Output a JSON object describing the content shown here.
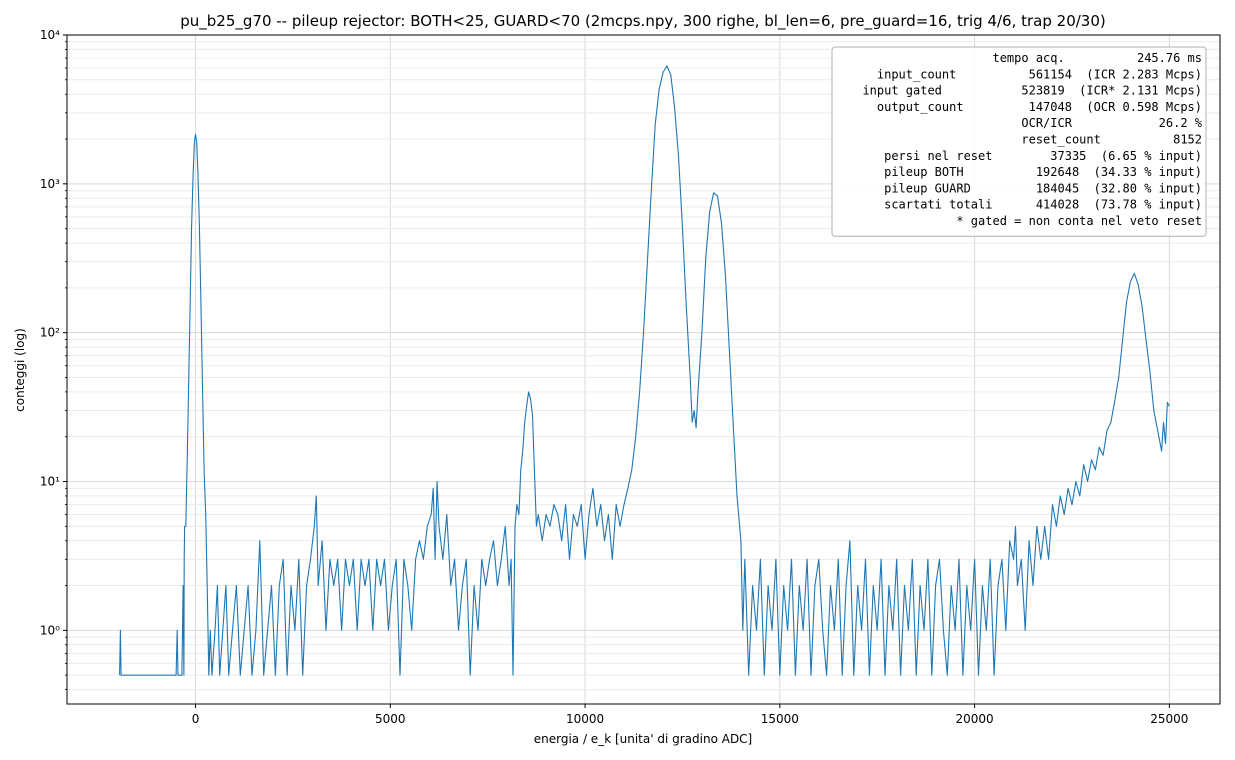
{
  "chart_data": {
    "type": "line",
    "title": "pu_b25_g70  --  pileup rejector: BOTH<25, GUARD<70   (2mcps.npy, 300 righe, bl_len=6, pre_guard=16, trig 4/6, trap 20/30)",
    "xlabel": "energia / e_k  [unita' di gradino ADC]",
    "ylabel": "conteggi (log)",
    "xlim": [
      -3300,
      26300
    ],
    "ylim": [
      0.32,
      10000
    ],
    "yscale": "log",
    "grid": true,
    "x_ticks": [
      0,
      5000,
      10000,
      15000,
      20000,
      25000
    ],
    "x_tick_labels": [
      "0",
      "5000",
      "10000",
      "15000",
      "20000",
      "25000"
    ],
    "y_ticks": [
      1,
      10,
      100,
      1000,
      10000
    ],
    "y_tick_labels": [
      "10⁰",
      "10¹",
      "10²",
      "10³",
      "10⁴"
    ],
    "line_color": "#1f77b4",
    "series": [
      {
        "name": "",
        "points": [
          [
            -1950,
            0.5
          ],
          [
            -1930,
            1.0
          ],
          [
            -1910,
            0.5
          ],
          [
            -500,
            0.5
          ],
          [
            -470,
            1.0
          ],
          [
            -450,
            0.5
          ],
          [
            -350,
            0.5
          ],
          [
            -320,
            2.0
          ],
          [
            -300,
            0.5
          ],
          [
            -290,
            3.0
          ],
          [
            -280,
            5.0
          ],
          [
            -250,
            5.0
          ],
          [
            -220,
            12
          ],
          [
            -180,
            40
          ],
          [
            -140,
            150
          ],
          [
            -100,
            520
          ],
          [
            -60,
            1200
          ],
          [
            -30,
            1900
          ],
          [
            0,
            2150
          ],
          [
            30,
            1900
          ],
          [
            60,
            1200
          ],
          [
            100,
            520
          ],
          [
            140,
            150
          ],
          [
            180,
            40
          ],
          [
            220,
            12
          ],
          [
            260,
            6
          ],
          [
            300,
            2.0
          ],
          [
            340,
            0.5
          ],
          [
            380,
            1.0
          ],
          [
            420,
            0.5
          ],
          [
            500,
            1.0
          ],
          [
            560,
            2.0
          ],
          [
            620,
            0.5
          ],
          [
            700,
            1.0
          ],
          [
            780,
            2.0
          ],
          [
            850,
            0.5
          ],
          [
            950,
            1.0
          ],
          [
            1050,
            2.0
          ],
          [
            1150,
            0.5
          ],
          [
            1250,
            1.0
          ],
          [
            1350,
            2.0
          ],
          [
            1450,
            0.5
          ],
          [
            1550,
            1.0
          ],
          [
            1650,
            4.0
          ],
          [
            1750,
            0.5
          ],
          [
            1850,
            1.0
          ],
          [
            1950,
            2.0
          ],
          [
            2050,
            0.5
          ],
          [
            2150,
            2.0
          ],
          [
            2250,
            3.0
          ],
          [
            2350,
            0.5
          ],
          [
            2450,
            2.0
          ],
          [
            2550,
            1.0
          ],
          [
            2650,
            3.0
          ],
          [
            2750,
            0.5
          ],
          [
            2850,
            2.0
          ],
          [
            2950,
            3.0
          ],
          [
            3050,
            5.0
          ],
          [
            3100,
            8.0
          ],
          [
            3150,
            2.0
          ],
          [
            3250,
            4.0
          ],
          [
            3350,
            1.0
          ],
          [
            3450,
            3.0
          ],
          [
            3550,
            2.0
          ],
          [
            3650,
            3.0
          ],
          [
            3750,
            1.0
          ],
          [
            3850,
            3.0
          ],
          [
            3950,
            2.0
          ],
          [
            4050,
            3.0
          ],
          [
            4150,
            1.0
          ],
          [
            4250,
            3.0
          ],
          [
            4350,
            2.0
          ],
          [
            4450,
            3.0
          ],
          [
            4550,
            1.0
          ],
          [
            4650,
            3.0
          ],
          [
            4750,
            2.0
          ],
          [
            4850,
            3.0
          ],
          [
            4950,
            1.0
          ],
          [
            5050,
            2.0
          ],
          [
            5150,
            3.0
          ],
          [
            5250,
            0.5
          ],
          [
            5350,
            3.0
          ],
          [
            5450,
            2.0
          ],
          [
            5550,
            1.0
          ],
          [
            5650,
            3.0
          ],
          [
            5750,
            4.0
          ],
          [
            5850,
            3.0
          ],
          [
            5950,
            5.0
          ],
          [
            6050,
            6.0
          ],
          [
            6100,
            9.0
          ],
          [
            6150,
            3.0
          ],
          [
            6200,
            10.0
          ],
          [
            6250,
            5.0
          ],
          [
            6350,
            3.0
          ],
          [
            6450,
            6.0
          ],
          [
            6550,
            2.0
          ],
          [
            6650,
            3.0
          ],
          [
            6750,
            1.0
          ],
          [
            6850,
            2.0
          ],
          [
            6950,
            3.0
          ],
          [
            7050,
            0.5
          ],
          [
            7150,
            2.0
          ],
          [
            7250,
            1.0
          ],
          [
            7350,
            3.0
          ],
          [
            7450,
            2.0
          ],
          [
            7550,
            3.0
          ],
          [
            7650,
            4.0
          ],
          [
            7750,
            2.0
          ],
          [
            7850,
            3.0
          ],
          [
            7950,
            5.0
          ],
          [
            8050,
            2.0
          ],
          [
            8100,
            3.0
          ],
          [
            8150,
            0.5
          ],
          [
            8200,
            5.0
          ],
          [
            8250,
            7.0
          ],
          [
            8300,
            6.0
          ],
          [
            8350,
            12
          ],
          [
            8400,
            16
          ],
          [
            8450,
            25
          ],
          [
            8500,
            32
          ],
          [
            8550,
            40
          ],
          [
            8600,
            36
          ],
          [
            8650,
            28
          ],
          [
            8700,
            12
          ],
          [
            8750,
            5.0
          ],
          [
            8800,
            6.0
          ],
          [
            8900,
            4.0
          ],
          [
            9000,
            6.0
          ],
          [
            9100,
            5.0
          ],
          [
            9200,
            7.0
          ],
          [
            9300,
            6.0
          ],
          [
            9400,
            4.0
          ],
          [
            9500,
            7.0
          ],
          [
            9600,
            3.0
          ],
          [
            9700,
            6.0
          ],
          [
            9800,
            5.0
          ],
          [
            9900,
            7.0
          ],
          [
            10000,
            3.0
          ],
          [
            10100,
            6.0
          ],
          [
            10200,
            9.0
          ],
          [
            10300,
            5.0
          ],
          [
            10400,
            7.0
          ],
          [
            10500,
            4.0
          ],
          [
            10600,
            6.0
          ],
          [
            10700,
            3.0
          ],
          [
            10800,
            7.0
          ],
          [
            10900,
            5.0
          ],
          [
            11000,
            7.0
          ],
          [
            11100,
            9.0
          ],
          [
            11200,
            12
          ],
          [
            11300,
            20
          ],
          [
            11400,
            40
          ],
          [
            11500,
            100
          ],
          [
            11600,
            300
          ],
          [
            11700,
            900
          ],
          [
            11800,
            2500
          ],
          [
            11900,
            4300
          ],
          [
            12000,
            5600
          ],
          [
            12100,
            6200
          ],
          [
            12200,
            5400
          ],
          [
            12300,
            3200
          ],
          [
            12400,
            1500
          ],
          [
            12500,
            500
          ],
          [
            12600,
            150
          ],
          [
            12700,
            50
          ],
          [
            12750,
            25
          ],
          [
            12800,
            30
          ],
          [
            12850,
            23
          ],
          [
            12900,
            40
          ],
          [
            13000,
            100
          ],
          [
            13100,
            320
          ],
          [
            13200,
            650
          ],
          [
            13300,
            870
          ],
          [
            13400,
            830
          ],
          [
            13500,
            550
          ],
          [
            13600,
            250
          ],
          [
            13700,
            80
          ],
          [
            13800,
            25
          ],
          [
            13900,
            8.0
          ],
          [
            14000,
            4.0
          ],
          [
            14050,
            1.0
          ],
          [
            14100,
            3.0
          ],
          [
            14200,
            0.5
          ],
          [
            14300,
            2.0
          ],
          [
            14400,
            1.0
          ],
          [
            14500,
            3.0
          ],
          [
            14600,
            0.5
          ],
          [
            14700,
            2.0
          ],
          [
            14800,
            1.0
          ],
          [
            14900,
            3.0
          ],
          [
            15000,
            0.5
          ],
          [
            15100,
            2.0
          ],
          [
            15200,
            1.0
          ],
          [
            15300,
            3.0
          ],
          [
            15400,
            0.5
          ],
          [
            15500,
            2.0
          ],
          [
            15600,
            1.0
          ],
          [
            15700,
            3.0
          ],
          [
            15800,
            0.5
          ],
          [
            15900,
            2.0
          ],
          [
            16000,
            3.0
          ],
          [
            16100,
            1.0
          ],
          [
            16200,
            0.5
          ],
          [
            16300,
            2.0
          ],
          [
            16400,
            1.0
          ],
          [
            16500,
            3.0
          ],
          [
            16600,
            0.5
          ],
          [
            16700,
            2.0
          ],
          [
            16800,
            4.0
          ],
          [
            16900,
            0.5
          ],
          [
            17000,
            2.0
          ],
          [
            17100,
            1.0
          ],
          [
            17200,
            3.0
          ],
          [
            17300,
            0.5
          ],
          [
            17400,
            2.0
          ],
          [
            17500,
            1.0
          ],
          [
            17600,
            3.0
          ],
          [
            17700,
            0.5
          ],
          [
            17800,
            2.0
          ],
          [
            17900,
            1.0
          ],
          [
            18000,
            3.0
          ],
          [
            18100,
            0.5
          ],
          [
            18200,
            2.0
          ],
          [
            18300,
            1.0
          ],
          [
            18400,
            3.0
          ],
          [
            18500,
            0.5
          ],
          [
            18600,
            2.0
          ],
          [
            18700,
            1.0
          ],
          [
            18800,
            3.0
          ],
          [
            18900,
            0.5
          ],
          [
            19000,
            2.0
          ],
          [
            19100,
            3.0
          ],
          [
            19200,
            1.0
          ],
          [
            19300,
            0.5
          ],
          [
            19400,
            2.0
          ],
          [
            19500,
            1.0
          ],
          [
            19600,
            3.0
          ],
          [
            19700,
            0.5
          ],
          [
            19800,
            2.0
          ],
          [
            19900,
            1.0
          ],
          [
            20000,
            3.0
          ],
          [
            20100,
            0.5
          ],
          [
            20200,
            2.0
          ],
          [
            20300,
            1.0
          ],
          [
            20400,
            3.0
          ],
          [
            20500,
            0.5
          ],
          [
            20600,
            2.0
          ],
          [
            20700,
            3.0
          ],
          [
            20800,
            1.0
          ],
          [
            20900,
            4.0
          ],
          [
            21000,
            3.0
          ],
          [
            21050,
            5.0
          ],
          [
            21100,
            2.0
          ],
          [
            21200,
            3.0
          ],
          [
            21300,
            1.0
          ],
          [
            21400,
            4.0
          ],
          [
            21500,
            2.0
          ],
          [
            21600,
            5.0
          ],
          [
            21700,
            3.0
          ],
          [
            21800,
            5.0
          ],
          [
            21900,
            3.0
          ],
          [
            22000,
            7.0
          ],
          [
            22100,
            5.0
          ],
          [
            22200,
            8.0
          ],
          [
            22300,
            6.0
          ],
          [
            22400,
            9.0
          ],
          [
            22500,
            7.0
          ],
          [
            22600,
            10.0
          ],
          [
            22700,
            8.0
          ],
          [
            22800,
            13.0
          ],
          [
            22900,
            10.0
          ],
          [
            23000,
            14.0
          ],
          [
            23100,
            12.0
          ],
          [
            23200,
            17.0
          ],
          [
            23300,
            15.0
          ],
          [
            23400,
            22.0
          ],
          [
            23500,
            25.0
          ],
          [
            23600,
            35.0
          ],
          [
            23700,
            50.0
          ],
          [
            23800,
            90.0
          ],
          [
            23900,
            160.0
          ],
          [
            24000,
            220.0
          ],
          [
            24100,
            250.0
          ],
          [
            24200,
            210.0
          ],
          [
            24300,
            150.0
          ],
          [
            24400,
            90.0
          ],
          [
            24500,
            55.0
          ],
          [
            24600,
            30.0
          ],
          [
            24700,
            22.0
          ],
          [
            24800,
            16.0
          ],
          [
            24850,
            25.0
          ],
          [
            24900,
            18.0
          ],
          [
            24950,
            34.0
          ],
          [
            25000,
            32.0
          ]
        ]
      }
    ],
    "legend": {
      "placement": "top-right",
      "lines": [
        "           tempo acq.          245.76 ms",
        " input_count          561154  (ICR 2.283 Mcps)",
        "input gated           523819  (ICR* 2.131 Mcps)",
        " output_count         147048  (OCR 0.598 Mcps)",
        "                OCR/ICR            26.2 %",
        "                  reset_count          8152",
        "   persi nel reset        37335  (6.65 % input)",
        "  pileup BOTH          192648  (34.33 % input)",
        "  pileup GUARD         184045  (32.80 % input)",
        "  scartati totali      414028  (73.78 % input)",
        "            * gated = non conta nel veto reset"
      ]
    }
  }
}
